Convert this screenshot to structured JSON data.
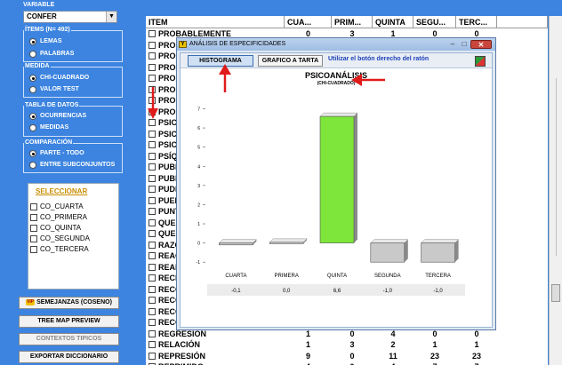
{
  "left": {
    "variable_label": "VARIABLE",
    "variable_value": "CONFER",
    "items_group": {
      "title": "ÍTEMS (N= 492)",
      "options": [
        "LEMAS",
        "PALABRAS"
      ],
      "selected": 0
    },
    "medida_group": {
      "title": "MEDIDA",
      "options": [
        "CHI-CUADRADO",
        "VALOR TEST"
      ],
      "selected": 0
    },
    "tabla_group": {
      "title": "TABLA DE DATOS",
      "options": [
        "OCURRENCIAS",
        "MEDIDAS"
      ],
      "selected": 0
    },
    "comparacion_group": {
      "title": "COMPARACIÓN",
      "options": [
        "PARTE - TODO",
        "ENTRE SUBCONJUNTOS"
      ],
      "selected": 0
    },
    "seleccionar": {
      "title": "SELECCIONAR",
      "items": [
        "CO_CUARTA",
        "CO_PRIMERA",
        "CO_QUINTA",
        "CO_SEGUNDA",
        "CO_TERCERA"
      ]
    },
    "buttons": {
      "semejanzas": "SEMEJANZAS (COSENO)",
      "semejanzas_badge": "VIP",
      "tree_map": "TREE MAP PREVIEW",
      "contextos": "CONTEXTOS TIPICOS",
      "exportar": "EXPORTAR DICCIONARIO"
    }
  },
  "table": {
    "headers": [
      "ITEM",
      "CUA...",
      "PRIM...",
      "QUINTA",
      "SEGU...",
      "TERC..."
    ],
    "rows": [
      {
        "item": "PROBABLEMENTE",
        "v": [
          "0",
          "3",
          "1",
          "0",
          "0"
        ]
      },
      {
        "item": "PROBL",
        "v": [
          "",
          "",
          "",
          "",
          ""
        ]
      },
      {
        "item": "PROC",
        "v": [
          "",
          "",
          "",
          "",
          ""
        ]
      },
      {
        "item": "PROC",
        "v": [
          "",
          "",
          "",
          "",
          ""
        ]
      },
      {
        "item": "PROD",
        "v": [
          "",
          "",
          "",
          "",
          ""
        ]
      },
      {
        "item": "PROD",
        "v": [
          "",
          "",
          "",
          "",
          ""
        ]
      },
      {
        "item": "PROD",
        "v": [
          "",
          "",
          "",
          "",
          ""
        ]
      },
      {
        "item": "PROF",
        "v": [
          "",
          "",
          "",
          "",
          ""
        ]
      },
      {
        "item": "PSICO",
        "v": [
          "",
          "",
          "",
          "",
          ""
        ]
      },
      {
        "item": "PSICO",
        "v": [
          "",
          "",
          "",
          "",
          ""
        ]
      },
      {
        "item": "PSICO",
        "v": [
          "",
          "",
          "",
          "",
          ""
        ]
      },
      {
        "item": "PSÍQU",
        "v": [
          "",
          "",
          "",
          "",
          ""
        ]
      },
      {
        "item": "PUBE",
        "v": [
          "",
          "",
          "",
          "",
          ""
        ]
      },
      {
        "item": "PUBLI",
        "v": [
          "",
          "",
          "",
          "",
          ""
        ]
      },
      {
        "item": "PUDIE",
        "v": [
          "",
          "",
          "",
          "",
          ""
        ]
      },
      {
        "item": "PUER",
        "v": [
          "",
          "",
          "",
          "",
          ""
        ]
      },
      {
        "item": "PUNT",
        "v": [
          "",
          "",
          "",
          "",
          ""
        ]
      },
      {
        "item": "QUED",
        "v": [
          "",
          "",
          "",
          "",
          ""
        ]
      },
      {
        "item": "QUED",
        "v": [
          "",
          "",
          "",
          "",
          ""
        ]
      },
      {
        "item": "RAZÓ",
        "v": [
          "",
          "",
          "",
          "",
          ""
        ]
      },
      {
        "item": "REAC",
        "v": [
          "",
          "",
          "",
          "",
          ""
        ]
      },
      {
        "item": "REALI",
        "v": [
          "",
          "",
          "",
          "",
          ""
        ]
      },
      {
        "item": "RECH",
        "v": [
          "",
          "",
          "",
          "",
          ""
        ]
      },
      {
        "item": "RECO",
        "v": [
          "",
          "",
          "",
          "",
          ""
        ]
      },
      {
        "item": "RECO",
        "v": [
          "",
          "",
          "",
          "",
          ""
        ]
      },
      {
        "item": "RECO",
        "v": [
          "",
          "",
          "",
          "",
          ""
        ]
      },
      {
        "item": "RECO",
        "v": [
          "",
          "",
          "",
          "",
          ""
        ]
      },
      {
        "item": "REGRESIÓN",
        "v": [
          "1",
          "0",
          "4",
          "0",
          "0"
        ]
      },
      {
        "item": "RELACIÓN",
        "v": [
          "1",
          "3",
          "2",
          "1",
          "1"
        ]
      },
      {
        "item": "REPRESIÓN",
        "v": [
          "9",
          "0",
          "11",
          "23",
          "23"
        ]
      },
      {
        "item": "REPRIMIDO",
        "v": [
          "4",
          "0",
          "4",
          "7",
          "7"
        ]
      }
    ]
  },
  "dialog": {
    "title": "ANÁLISIS DE ESPECIFICIDADES",
    "app_icon": "Y",
    "tabs": [
      "HISTOGRAMA",
      "GRAFICO A TARTA"
    ],
    "active_tab": 0,
    "hint": "Utilizar el botón derecho del ratón",
    "excel_icon": "excel-icon"
  },
  "chart_data": {
    "type": "bar",
    "title": "PSICOANÁLISIS",
    "subtitle": "(CHI-CUADRADO)",
    "categories": [
      "CUARTA",
      "PRIMERA",
      "QUINTA",
      "SEGUNDA",
      "TERCERA"
    ],
    "values": [
      -0.1,
      0.0,
      6.6,
      -1.0,
      -1.0
    ],
    "value_labels": [
      "-0,1",
      "0,0",
      "6,6",
      "-1,0",
      "-1,0"
    ],
    "ylim": [
      -1.5,
      7.3
    ],
    "yticks": [
      -1,
      0,
      1,
      2,
      3,
      4,
      5,
      6,
      7
    ],
    "grid": false,
    "legend": "none",
    "colors": {
      "highlight": "#7ee53a",
      "normal": "#c9c9c9"
    }
  },
  "colors": {
    "background": "#3c84e0",
    "arrow": "#e01b1b"
  }
}
